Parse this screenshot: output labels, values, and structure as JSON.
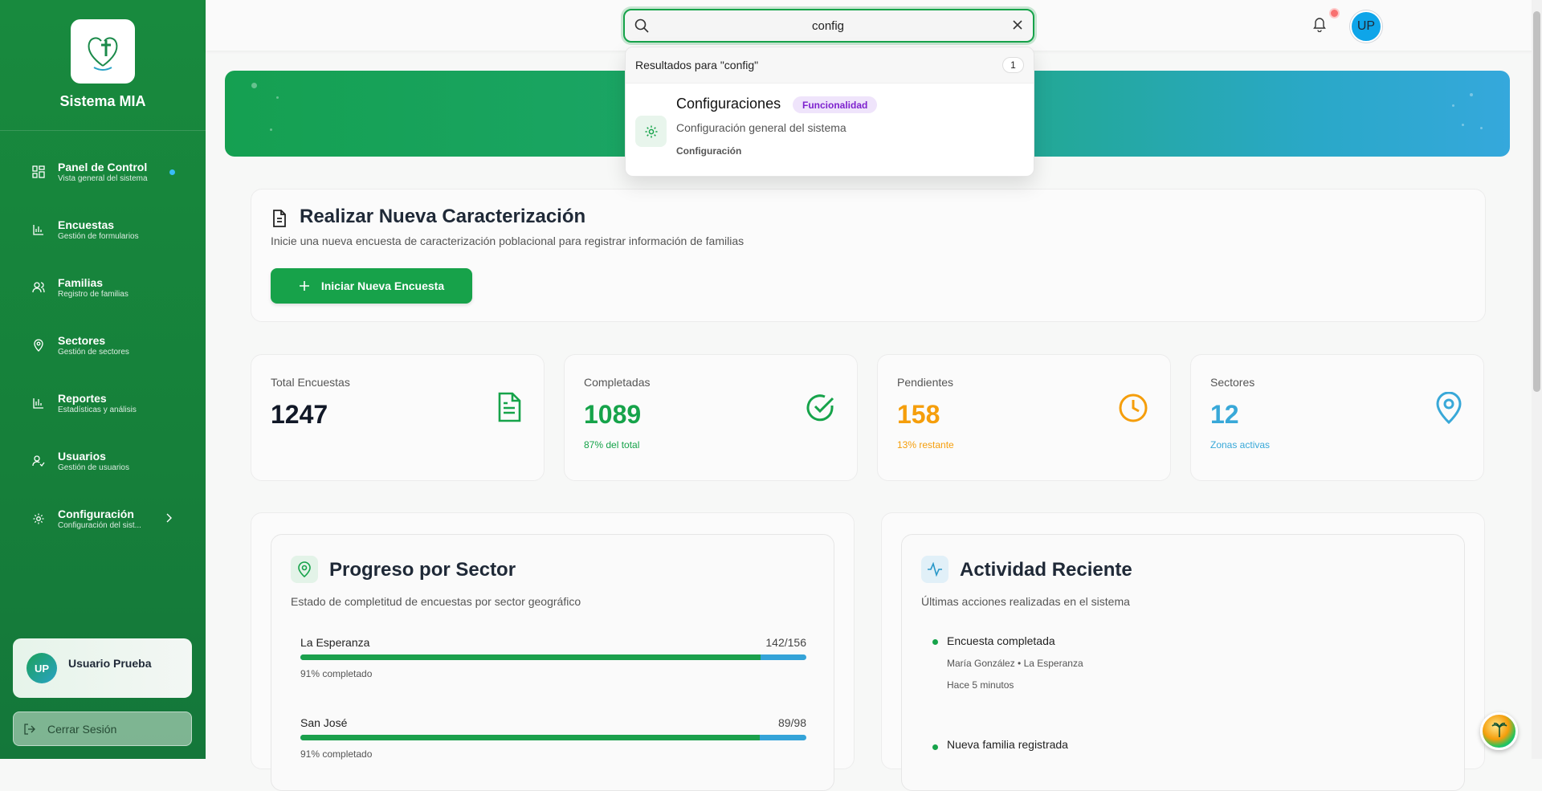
{
  "sidebar": {
    "brand": "Sistema MIA",
    "items": [
      {
        "label": "Panel de Control",
        "sub": "Vista general del sistema"
      },
      {
        "label": "Encuestas",
        "sub": "Gestión de formularios"
      },
      {
        "label": "Familias",
        "sub": "Registro de familias"
      },
      {
        "label": "Sectores",
        "sub": "Gestión de sectores"
      },
      {
        "label": "Reportes",
        "sub": "Estadísticas y análisis"
      },
      {
        "label": "Usuarios",
        "sub": "Gestión de usuarios"
      },
      {
        "label": "Configuración",
        "sub": "Configuración del sist..."
      }
    ],
    "user": {
      "initials": "UP",
      "name": "Usuario Prueba"
    },
    "logout": "Cerrar Sesión"
  },
  "topbar": {
    "search_value": "config",
    "avatar": "UP"
  },
  "search_results": {
    "header": "Resultados para \"config\"",
    "count": "1",
    "item": {
      "title": "Configuraciones",
      "badge": "Funcionalidad",
      "desc": "Configuración general del sistema",
      "category": "Configuración"
    }
  },
  "new_survey": {
    "title": "Realizar Nueva Caracterización",
    "desc": "Inicie una nueva encuesta de caracterización poblacional para registrar información de familias",
    "button": "Iniciar Nueva Encuesta"
  },
  "stats": [
    {
      "label": "Total Encuestas",
      "value": "1247",
      "sub": "",
      "color": "#111827"
    },
    {
      "label": "Completadas",
      "value": "1089",
      "sub": "87% del total",
      "color": "#16a34a"
    },
    {
      "label": "Pendientes",
      "value": "158",
      "sub": "13% restante",
      "color": "#f59e0b"
    },
    {
      "label": "Sectores",
      "value": "12",
      "sub": "Zonas activas",
      "color": "#38a8d8"
    }
  ],
  "progress": {
    "title": "Progreso por Sector",
    "desc": "Estado de completitud de encuestas por sector geográfico",
    "sectors": [
      {
        "name": "La Esperanza",
        "count": "142/156",
        "pct_text": "91% completado",
        "fraction": 0.91
      },
      {
        "name": "San José",
        "count": "89/98",
        "pct_text": "91% completado",
        "fraction": 0.908
      }
    ]
  },
  "activity": {
    "title": "Actividad Reciente",
    "desc": "Últimas acciones realizadas en el sistema",
    "items": [
      {
        "title": "Encuesta completada",
        "meta": "María González • La Esperanza",
        "time": "Hace 5 minutos"
      },
      {
        "title": "Nueva familia registrada",
        "meta": "",
        "time": ""
      }
    ]
  },
  "colors": {
    "primary": "#17a24a",
    "accent": "#38a8d8",
    "warning": "#f59e0b",
    "badge": "#7e22ce"
  }
}
